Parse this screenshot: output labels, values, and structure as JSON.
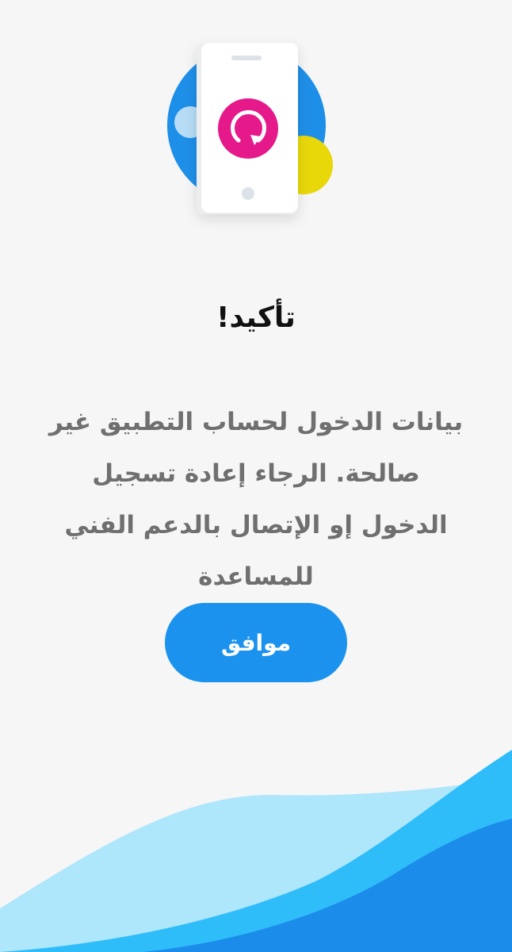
{
  "dialog": {
    "title": "تأكيد!",
    "message": "بيانات الدخول لحساب التطبيق غير صالحة. الرجاء إعادة تسجيل الدخول إو الإتصال بالدعم الفني للمساعدة",
    "ok_label": "موافق"
  },
  "illustration": {
    "icon": "refresh-icon",
    "colors": {
      "blue_circle": "#1e8fe8",
      "yellow_circle": "#e8d80a",
      "pink_circle": "#e6198a",
      "light_blue_circle": "#b6dcf6"
    }
  },
  "theme": {
    "accent": "#1b93ee",
    "background": "#f6f6f6",
    "wave_light": "#aee6fb",
    "wave_mid": "#2fbdfa",
    "wave_dark": "#1b8cea"
  }
}
